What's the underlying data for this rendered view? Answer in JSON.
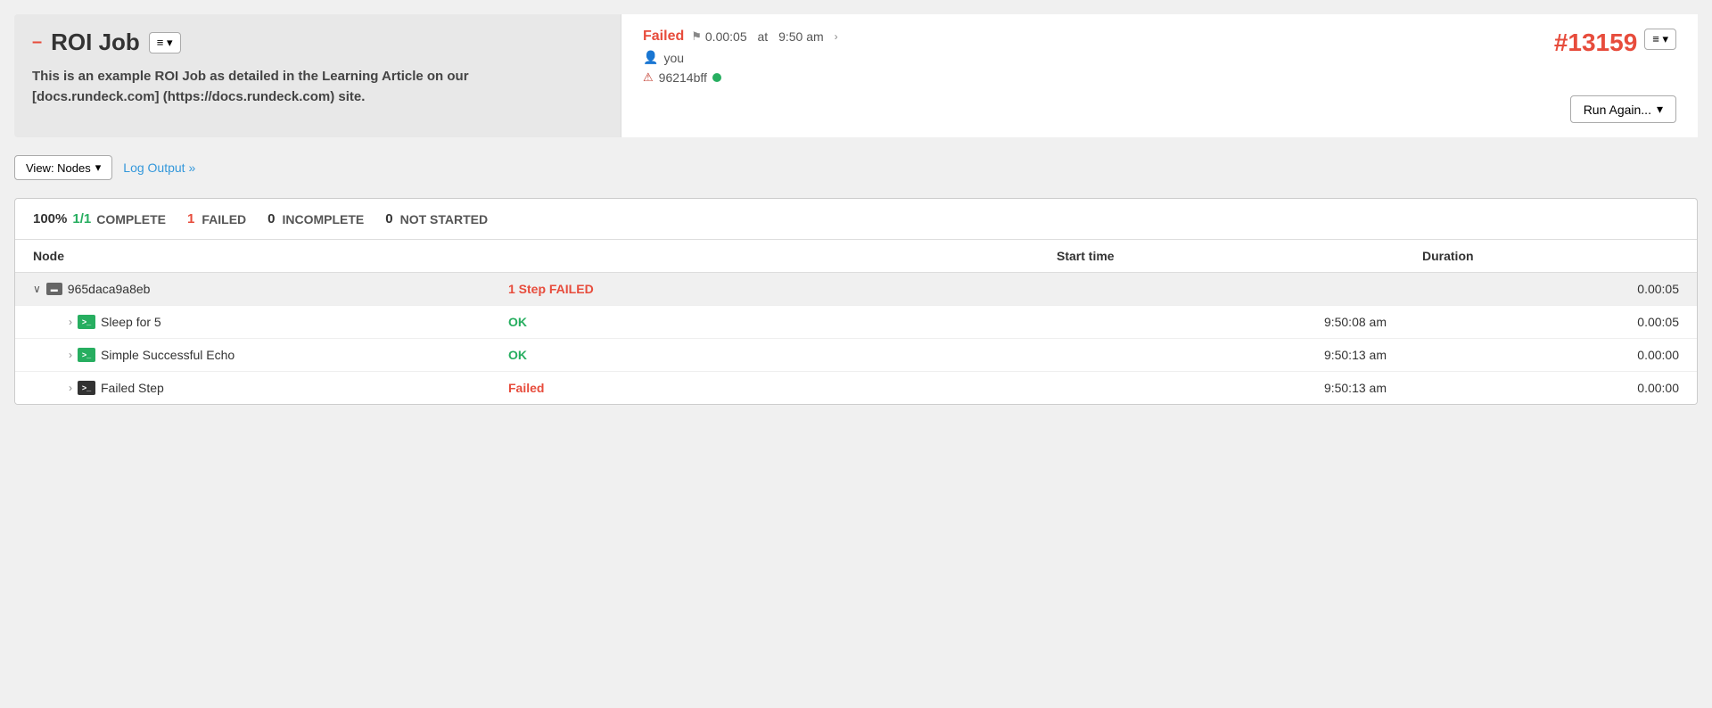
{
  "header": {
    "dash": "–",
    "title": "ROI Job",
    "menu_button_label": "≡ ▾",
    "description": "This is an example ROI Job as detailed in the Learning Article on our [docs.rundeck.com] (https://docs.rundeck.com) site."
  },
  "execution": {
    "status": "Failed",
    "flag_icon": "⚑",
    "duration": "0.00:05",
    "at_label": "at",
    "time": "9:50 am",
    "chevron": "›",
    "user_icon": "👤",
    "user": "you",
    "node_icon": "⚠",
    "node_id": "96214bff",
    "execution_id": "#13159",
    "menu_button_label": "≡ ▾",
    "run_again_label": "Run Again...",
    "run_again_chevron": "▾"
  },
  "toolbar": {
    "view_nodes_label": "View: Nodes",
    "view_nodes_chevron": "▾",
    "log_output_label": "Log Output »"
  },
  "stats": {
    "percent": "100%",
    "fraction": "1/1",
    "complete_label": "COMPLETE",
    "failed_count": "1",
    "failed_label": "FAILED",
    "incomplete_count": "0",
    "incomplete_label": "INCOMPLETE",
    "not_started_count": "0",
    "not_started_label": "NOT STARTED"
  },
  "table": {
    "col_node": "Node",
    "col_starttime": "Start time",
    "col_duration": "Duration",
    "node_group": {
      "chevron": "∨",
      "server_icon": "▬",
      "name": "965daca9a8eb",
      "step_failed_text": "1 Step FAILED",
      "duration": "0.00:05"
    },
    "steps": [
      {
        "expand": "›",
        "icon_type": "green",
        "name": "Sleep for 5",
        "status": "OK",
        "start_time": "9:50:08 am",
        "duration": "0.00:05"
      },
      {
        "expand": "›",
        "icon_type": "green",
        "name": "Simple Successful Echo",
        "status": "OK",
        "start_time": "9:50:13 am",
        "duration": "0.00:00"
      },
      {
        "expand": "›",
        "icon_type": "dark",
        "name": "Failed Step",
        "status": "Failed",
        "start_time": "9:50:13 am",
        "duration": "0.00:00"
      }
    ]
  }
}
